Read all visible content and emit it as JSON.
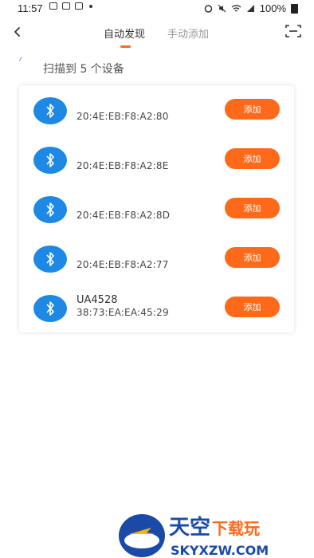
{
  "status": {
    "time": "11:57",
    "battery_text": "100%"
  },
  "header": {
    "tabs": [
      {
        "label": "自动发现",
        "active": true
      },
      {
        "label": "手动添加",
        "active": false
      }
    ],
    "accent_color": "#ff6a1a"
  },
  "scan": {
    "count_text": "扫描到 5 个设备"
  },
  "devices": [
    {
      "name": "",
      "mac": "20:4E:EB:F8:A2:80",
      "action": "添加"
    },
    {
      "name": "",
      "mac": "20:4E:EB:F8:A2:8E",
      "action": "添加"
    },
    {
      "name": "",
      "mac": "20:4E:EB:F8:A2:8D",
      "action": "添加"
    },
    {
      "name": "",
      "mac": "20:4E:EB:F8:A2:77",
      "action": "添加"
    },
    {
      "name": "UA4528",
      "mac": "38:73:EA:EA:45:29",
      "action": "添加"
    }
  ],
  "icons": {
    "back": "back-chevron-icon",
    "scan": "scan-frame-icon",
    "device": "bluetooth-icon"
  },
  "watermark": {
    "title": "天空下载",
    "site": "SKYXZW.COM"
  }
}
